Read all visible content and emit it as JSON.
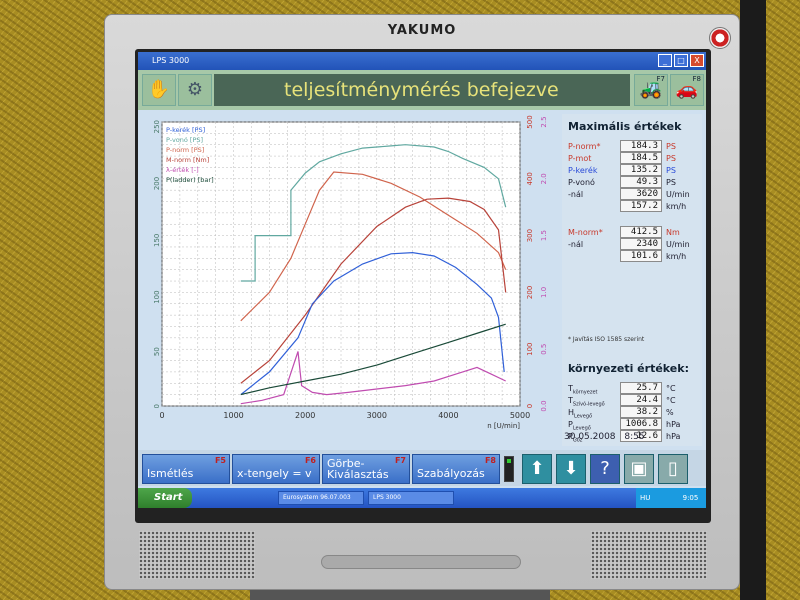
{
  "monitor": {
    "brand": "YAKUMO"
  },
  "window": {
    "title": "LPS 3000",
    "minimize": "_",
    "maximize": "□",
    "close": "X"
  },
  "header": {
    "status_text": "teljesítménymérés befejezve",
    "fkeys": {
      "f7": "F7",
      "f8": "F8"
    }
  },
  "chart_data": {
    "type": "line",
    "xlabel": "n [U/min]",
    "xlim": [
      0,
      5000
    ],
    "xticks": [
      0,
      1000,
      2000,
      3000,
      4000,
      5000
    ],
    "ylim_left": [
      0,
      250
    ],
    "yticks_left": [
      0,
      50,
      100,
      150,
      200,
      250
    ],
    "right_axes": [
      {
        "ticks": [
          0,
          100,
          200,
          300,
          400,
          500
        ],
        "color": "#c8392b"
      },
      {
        "ticks": [
          0.0,
          0.5,
          1.0,
          1.5,
          2.0,
          2.5
        ],
        "color": "#c04cb0"
      }
    ],
    "legend": [
      "P-kerék [PS]",
      "P-vonó [PS]",
      "P-norm [PS]",
      "M-norm [Nm]",
      "λ-érték [-]",
      "P(ladder) [bar]"
    ],
    "series": [
      {
        "name": "P-norm [PS]",
        "color": "#d0644c",
        "x": [
          1100,
          1500,
          1800,
          2000,
          2200,
          2400,
          2800,
          3200,
          3600,
          4000,
          4400,
          4700,
          4800
        ],
        "y": [
          75,
          100,
          130,
          160,
          190,
          206,
          204,
          196,
          184,
          168,
          152,
          135,
          120
        ]
      },
      {
        "name": "M-norm [Nm]",
        "color": "#b8433a",
        "x": [
          1100,
          1500,
          2000,
          2500,
          3000,
          3400,
          3700,
          4000,
          4300,
          4500,
          4700,
          4800
        ],
        "y": [
          20,
          40,
          80,
          125,
          158,
          175,
          182,
          183,
          180,
          173,
          155,
          100
        ]
      },
      {
        "name": "P-kerék [PS]",
        "color": "#3060d8",
        "x": [
          1100,
          1500,
          1900,
          2100,
          2400,
          2800,
          3200,
          3500,
          3800,
          4100,
          4400,
          4600,
          4700,
          4780
        ],
        "y": [
          10,
          30,
          60,
          90,
          110,
          125,
          134,
          135,
          132,
          122,
          107,
          95,
          78,
          30
        ]
      },
      {
        "name": "P-vonó [PS]",
        "color": "#60a8a0",
        "x": [
          1100,
          1300,
          1300,
          1800,
          1800,
          2000,
          2200,
          2500,
          2800,
          3000,
          3200,
          3400,
          3800,
          4000,
          4200,
          4500,
          4700,
          4800
        ],
        "y": [
          110,
          110,
          150,
          150,
          190,
          205,
          215,
          222,
          227,
          228,
          229,
          230,
          228,
          224,
          218,
          210,
          200,
          175
        ]
      },
      {
        "name": "λ-érték [-]",
        "color": "#c04cb0",
        "x": [
          1100,
          1400,
          1700,
          1900,
          1950,
          2100,
          2300,
          2600,
          3000,
          3400,
          3800,
          4100,
          4400,
          4600,
          4800
        ],
        "y": [
          2,
          5,
          10,
          48,
          18,
          12,
          10,
          12,
          15,
          18,
          22,
          28,
          34,
          28,
          22
        ]
      },
      {
        "name": "P(ladder) [bar]",
        "color": "#1a4a38",
        "x": [
          1100,
          1500,
          2000,
          2500,
          3000,
          3500,
          4000,
          4500,
          4800
        ],
        "y": [
          10,
          16,
          22,
          28,
          36,
          46,
          56,
          66,
          72
        ]
      }
    ]
  },
  "maximal": {
    "title": "Maximális értékek",
    "rows": [
      {
        "label": "P-norm*",
        "value": "184.3",
        "unit": "PS"
      },
      {
        "label": "P-mot",
        "value": "184.5",
        "unit": "PS"
      },
      {
        "label": "P-kerék",
        "value": "135.2",
        "unit": "PS"
      },
      {
        "label": "P-vonó",
        "value": "49.3",
        "unit": "PS"
      },
      {
        "label": "-nál",
        "value": "3620",
        "unit": "U/min"
      },
      {
        "label": "",
        "value": "157.2",
        "unit": "km/h"
      },
      {
        "label": "M-norm*",
        "value": "412.5",
        "unit": "Nm"
      },
      {
        "label": "-nál",
        "value": "2340",
        "unit": "U/min"
      },
      {
        "label": "",
        "value": "101.6",
        "unit": "km/h"
      }
    ],
    "note": "* Javítás ISO 1585 szerint"
  },
  "environment": {
    "title": "környezeti értékek:",
    "rows": [
      {
        "label": "T",
        "sub": "környezet",
        "value": "25.7",
        "unit": "°C"
      },
      {
        "label": "T",
        "sub": "Szívó-levegő",
        "value": "24.4",
        "unit": "°C"
      },
      {
        "label": "H",
        "sub": "Levegő",
        "value": "38.2",
        "unit": "%"
      },
      {
        "label": "P",
        "sub": "Levegő",
        "value": "1006.8",
        "unit": "hPa"
      },
      {
        "label": "P",
        "sub": "Gőz",
        "value": "12.6",
        "unit": "hPa"
      }
    ]
  },
  "datetime": {
    "date": "30.05.2008",
    "time": "8:55"
  },
  "fbar": {
    "repeat": {
      "label": "Ismétlés",
      "key": "F5"
    },
    "axis": {
      "label": "x-tengely = v",
      "key": "F6"
    },
    "curve": {
      "label1": "Görbe-",
      "label2": "Kiválasztás",
      "key": "F7"
    },
    "regulation": {
      "label": "Szabályozás",
      "key": "F8"
    }
  },
  "taskbar": {
    "start": "Start",
    "task1": "Eurosystem 96.07.003",
    "task2": "LPS 3000",
    "tray": "HU",
    "clock": "9:05"
  }
}
